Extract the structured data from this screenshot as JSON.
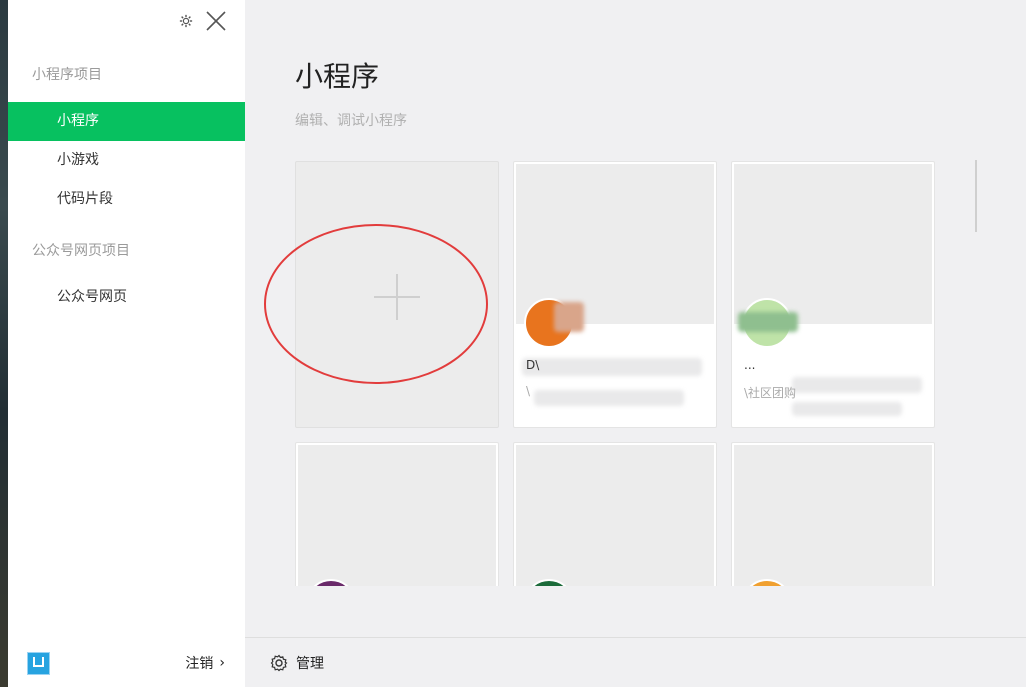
{
  "sidebar": {
    "sections": [
      {
        "title": "小程序项目",
        "items": [
          "小程序",
          "小游戏",
          "代码片段"
        ]
      },
      {
        "title": "公众号网页项目",
        "items": [
          "公众号网页"
        ]
      }
    ],
    "active_item": "小程序",
    "footer": {
      "logout_label": "注销",
      "logout_chevron": "›"
    },
    "icons": {
      "settings": "gear-icon",
      "close": "close-icon"
    }
  },
  "main": {
    "title": "小程序",
    "subtitle": "编辑、调试小程序",
    "projects": [
      {
        "type": "new",
        "icon": "plus-icon"
      },
      {
        "type": "project",
        "name": "D\\",
        "path": "\\",
        "avatar_color": "#e8741e"
      },
      {
        "type": "project",
        "name": "...",
        "path": "\\社区团购",
        "avatar_color": "#8fcf7f"
      },
      {
        "type": "project",
        "name": "",
        "path": "",
        "avatar_color": "#6a2a6a"
      },
      {
        "type": "project",
        "name": "",
        "path": "",
        "avatar_color": "#1c6b3a"
      },
      {
        "type": "project",
        "name": "",
        "path": "",
        "avatar_color": "#f0a030"
      }
    ]
  },
  "bottom_bar": {
    "manage_label": "管理"
  },
  "colors": {
    "accent": "#07c160",
    "annotation": "#e23c3c"
  }
}
